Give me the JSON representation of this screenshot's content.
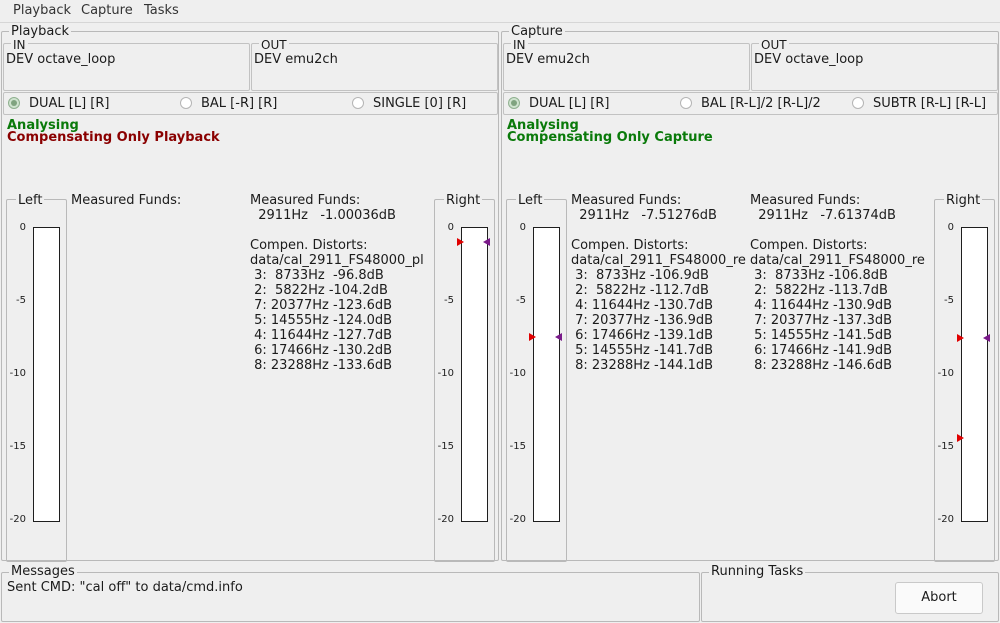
{
  "menu": {
    "items": [
      "Playback",
      "Capture",
      "Tasks"
    ]
  },
  "playback": {
    "title": "Playback",
    "in_label": "IN",
    "in_dev": "DEV octave_loop",
    "out_label": "OUT",
    "out_dev": "DEV emu2ch",
    "radios": [
      "DUAL [L] [R]",
      "BAL [-R] [R]",
      "SINGLE [0] [R]"
    ],
    "status1": "Analysing",
    "status2": "Compensating Only Playback",
    "left_label": "Left",
    "right_label": "Right",
    "mf_left_title": "Measured Funds:",
    "mf_right_title": "Measured Funds:",
    "mf_right_value": "  2911Hz   -1.00036dB",
    "cd_title": "Compen. Distorts:",
    "cd_file": "data/cal_2911_FS48000_pl",
    "cd_rows": [
      " 3:  8733Hz  -96.8dB",
      " 2:  5822Hz -104.2dB",
      " 7: 20377Hz -123.6dB",
      " 5: 14555Hz -124.0dB",
      " 4: 11644Hz -127.7dB",
      " 6: 17466Hz -130.2dB",
      " 8: 23288Hz -133.6dB"
    ],
    "right_meter_level_db": -1.0
  },
  "capture": {
    "title": "Capture",
    "in_label": "IN",
    "in_dev": "DEV emu2ch",
    "out_label": "OUT",
    "out_dev": "DEV octave_loop",
    "radios": [
      "DUAL [L] [R]",
      "BAL [R-L]/2 [R-L]/2",
      "SUBTR [R-L] [R-L]"
    ],
    "status1": "Analysing",
    "status2": "Compensating Only Capture",
    "left_label": "Left",
    "right_label": "Right",
    "mf_left_title": "Measured Funds:",
    "mf_left_value": "  2911Hz   -7.51276dB",
    "mf_right_title": "Measured Funds:",
    "mf_right_value": "  2911Hz   -7.61374dB",
    "cd_left_title": "Compen. Distorts:",
    "cd_left_file": "data/cal_2911_FS48000_re",
    "cd_left_rows": [
      " 3:  8733Hz -106.9dB",
      " 2:  5822Hz -112.7dB",
      " 4: 11644Hz -130.7dB",
      " 7: 20377Hz -136.9dB",
      " 6: 17466Hz -139.1dB",
      " 5: 14555Hz -141.7dB",
      " 8: 23288Hz -144.1dB"
    ],
    "cd_right_title": "Compen. Distorts:",
    "cd_right_file": "data/cal_2911_FS48000_re",
    "cd_right_rows": [
      " 3:  8733Hz -106.8dB",
      " 2:  5822Hz -113.7dB",
      " 4: 11644Hz -130.9dB",
      " 7: 20377Hz -137.3dB",
      " 5: 14555Hz -141.5dB",
      " 6: 17466Hz -141.9dB",
      " 8: 23288Hz -146.6dB"
    ],
    "left_meter_level_db": -7.5,
    "right_meter_level_db": -7.6,
    "right_meter_peak_db": -14.4
  },
  "meter_ticks": [
    "0",
    "-5",
    "-10",
    "-15",
    "-20"
  ],
  "messages": {
    "title": "Messages",
    "text": "Sent CMD: \"cal off\" to data/cmd.info"
  },
  "tasks": {
    "title": "Running Tasks",
    "abort_label": "Abort"
  },
  "colors": {
    "analysing": "#0a7a0a",
    "comp_playback": "#8a0000",
    "comp_capture": "#0a7a0a",
    "marker_red": "#e00000",
    "marker_purple": "#7a1a8a"
  }
}
